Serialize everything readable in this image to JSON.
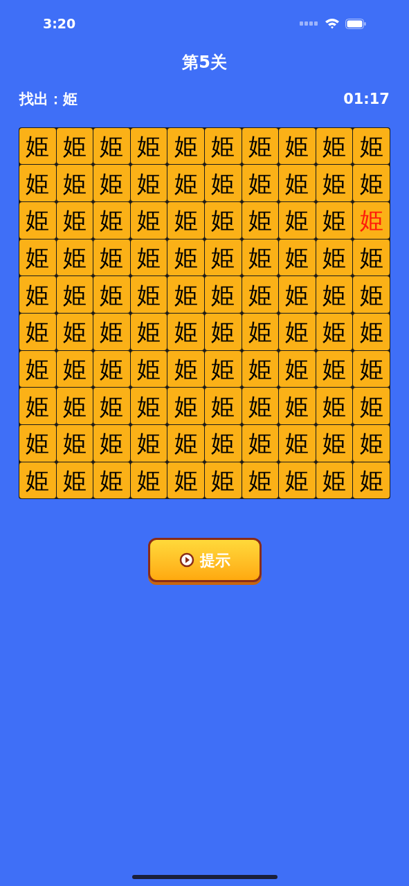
{
  "status_bar": {
    "time": "3:20"
  },
  "title": "第5关",
  "target": {
    "label": "找出：",
    "char": "姫"
  },
  "timer": "01:17",
  "grid": [
    [
      {
        "char": "姫",
        "highlighted": false
      },
      {
        "char": "姫",
        "highlighted": false
      },
      {
        "char": "姫",
        "highlighted": false
      },
      {
        "char": "姫",
        "highlighted": false
      },
      {
        "char": "姫",
        "highlighted": false
      },
      {
        "char": "姫",
        "highlighted": false
      },
      {
        "char": "姫",
        "highlighted": false
      },
      {
        "char": "姫",
        "highlighted": false
      },
      {
        "char": "姫",
        "highlighted": false
      },
      {
        "char": "姫",
        "highlighted": false
      }
    ],
    [
      {
        "char": "姫",
        "highlighted": false
      },
      {
        "char": "姫",
        "highlighted": false
      },
      {
        "char": "姫",
        "highlighted": false
      },
      {
        "char": "姫",
        "highlighted": false
      },
      {
        "char": "姫",
        "highlighted": false
      },
      {
        "char": "姫",
        "highlighted": false
      },
      {
        "char": "姫",
        "highlighted": false
      },
      {
        "char": "姫",
        "highlighted": false
      },
      {
        "char": "姫",
        "highlighted": false
      },
      {
        "char": "姫",
        "highlighted": false
      }
    ],
    [
      {
        "char": "姫",
        "highlighted": false
      },
      {
        "char": "姫",
        "highlighted": false
      },
      {
        "char": "姫",
        "highlighted": false
      },
      {
        "char": "姫",
        "highlighted": false
      },
      {
        "char": "姫",
        "highlighted": false
      },
      {
        "char": "姫",
        "highlighted": false
      },
      {
        "char": "姫",
        "highlighted": false
      },
      {
        "char": "姫",
        "highlighted": false
      },
      {
        "char": "姫",
        "highlighted": false
      },
      {
        "char": "姫",
        "highlighted": true
      }
    ],
    [
      {
        "char": "姫",
        "highlighted": false
      },
      {
        "char": "姫",
        "highlighted": false
      },
      {
        "char": "姫",
        "highlighted": false
      },
      {
        "char": "姫",
        "highlighted": false
      },
      {
        "char": "姫",
        "highlighted": false
      },
      {
        "char": "姫",
        "highlighted": false
      },
      {
        "char": "姫",
        "highlighted": false
      },
      {
        "char": "姫",
        "highlighted": false
      },
      {
        "char": "姫",
        "highlighted": false
      },
      {
        "char": "姫",
        "highlighted": false
      }
    ],
    [
      {
        "char": "姫",
        "highlighted": false
      },
      {
        "char": "姫",
        "highlighted": false
      },
      {
        "char": "姫",
        "highlighted": false
      },
      {
        "char": "姫",
        "highlighted": false
      },
      {
        "char": "姫",
        "highlighted": false
      },
      {
        "char": "姫",
        "highlighted": false
      },
      {
        "char": "姫",
        "highlighted": false
      },
      {
        "char": "姫",
        "highlighted": false
      },
      {
        "char": "姫",
        "highlighted": false
      },
      {
        "char": "姫",
        "highlighted": false
      }
    ],
    [
      {
        "char": "姫",
        "highlighted": false
      },
      {
        "char": "姫",
        "highlighted": false
      },
      {
        "char": "姫",
        "highlighted": false
      },
      {
        "char": "姫",
        "highlighted": false
      },
      {
        "char": "姫",
        "highlighted": false
      },
      {
        "char": "姫",
        "highlighted": false
      },
      {
        "char": "姫",
        "highlighted": false
      },
      {
        "char": "姫",
        "highlighted": false
      },
      {
        "char": "姫",
        "highlighted": false
      },
      {
        "char": "姫",
        "highlighted": false
      }
    ],
    [
      {
        "char": "姫",
        "highlighted": false
      },
      {
        "char": "姫",
        "highlighted": false
      },
      {
        "char": "姫",
        "highlighted": false
      },
      {
        "char": "姫",
        "highlighted": false
      },
      {
        "char": "姫",
        "highlighted": false
      },
      {
        "char": "姫",
        "highlighted": false
      },
      {
        "char": "姫",
        "highlighted": false
      },
      {
        "char": "姫",
        "highlighted": false
      },
      {
        "char": "姫",
        "highlighted": false
      },
      {
        "char": "姫",
        "highlighted": false
      }
    ],
    [
      {
        "char": "姫",
        "highlighted": false
      },
      {
        "char": "姫",
        "highlighted": false
      },
      {
        "char": "姫",
        "highlighted": false
      },
      {
        "char": "姫",
        "highlighted": false
      },
      {
        "char": "姫",
        "highlighted": false
      },
      {
        "char": "姫",
        "highlighted": false
      },
      {
        "char": "姫",
        "highlighted": false
      },
      {
        "char": "姫",
        "highlighted": false
      },
      {
        "char": "姫",
        "highlighted": false
      },
      {
        "char": "姫",
        "highlighted": false
      }
    ],
    [
      {
        "char": "姫",
        "highlighted": false
      },
      {
        "char": "姫",
        "highlighted": false
      },
      {
        "char": "姫",
        "highlighted": false
      },
      {
        "char": "姫",
        "highlighted": false
      },
      {
        "char": "姫",
        "highlighted": false
      },
      {
        "char": "姫",
        "highlighted": false
      },
      {
        "char": "姫",
        "highlighted": false
      },
      {
        "char": "姫",
        "highlighted": false
      },
      {
        "char": "姫",
        "highlighted": false
      },
      {
        "char": "姫",
        "highlighted": false
      }
    ],
    [
      {
        "char": "姫",
        "highlighted": false
      },
      {
        "char": "姫",
        "highlighted": false
      },
      {
        "char": "姫",
        "highlighted": false
      },
      {
        "char": "姫",
        "highlighted": false
      },
      {
        "char": "姫",
        "highlighted": false
      },
      {
        "char": "姫",
        "highlighted": false
      },
      {
        "char": "姫",
        "highlighted": false
      },
      {
        "char": "姫",
        "highlighted": false
      },
      {
        "char": "姫",
        "highlighted": false
      },
      {
        "char": "姫",
        "highlighted": false
      }
    ]
  ],
  "hint_button": {
    "label": "提示"
  }
}
